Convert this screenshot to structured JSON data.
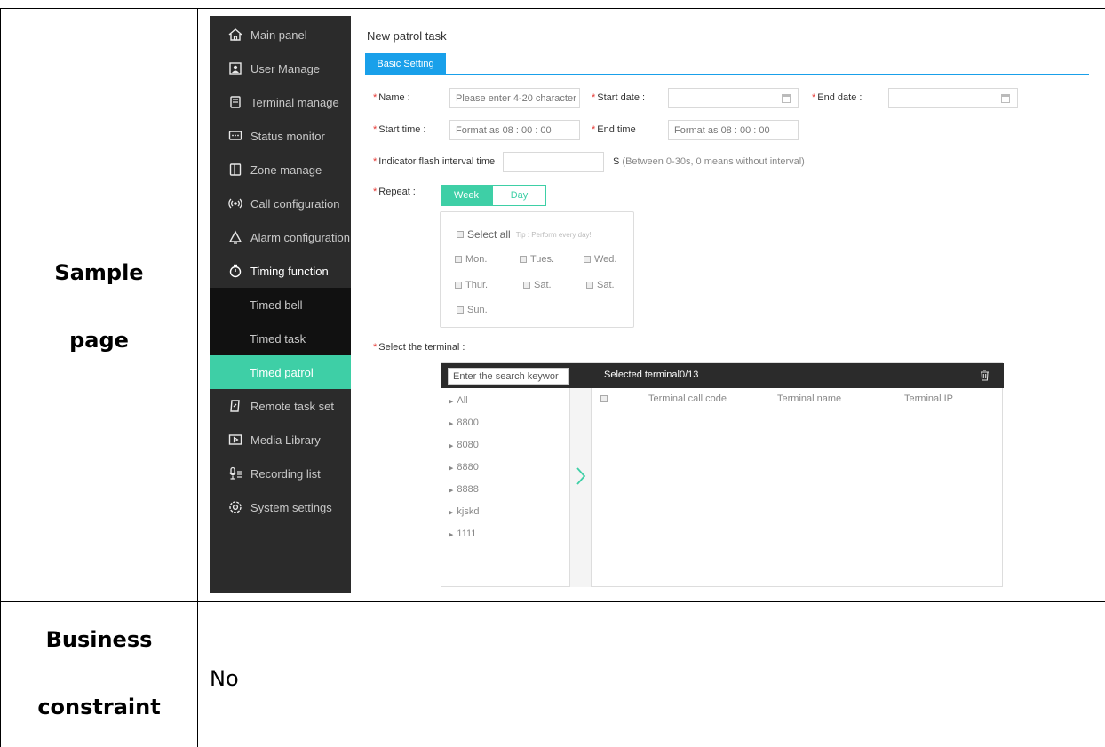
{
  "doc": {
    "row1_label_line1": "Sample",
    "row1_label_line2": "page",
    "row2_label_line1": "Business",
    "row2_label_line2": "constraint",
    "row2_value": "No"
  },
  "sidebar": {
    "items": [
      {
        "label": "Main panel",
        "icon": "home-icon"
      },
      {
        "label": "User Manage",
        "icon": "user-card-icon"
      },
      {
        "label": "Terminal manage",
        "icon": "terminal-icon"
      },
      {
        "label": "Status monitor",
        "icon": "monitor-icon"
      },
      {
        "label": "Zone manage",
        "icon": "zone-icon"
      },
      {
        "label": "Call configuration",
        "icon": "broadcast-icon"
      },
      {
        "label": "Alarm configuration",
        "icon": "bell-icon"
      },
      {
        "label": "Timing function",
        "icon": "stopwatch-icon"
      },
      {
        "label": "Timed bell"
      },
      {
        "label": "Timed task"
      },
      {
        "label": "Timed patrol"
      },
      {
        "label": "Remote task set",
        "icon": "remote-task-icon"
      },
      {
        "label": "Media Library",
        "icon": "media-icon"
      },
      {
        "label": "Recording list",
        "icon": "microphone-icon"
      },
      {
        "label": "System settings",
        "icon": "gear-icon"
      }
    ]
  },
  "form": {
    "title": "New patrol task",
    "tab": "Basic Setting",
    "star": "*",
    "name_label": "Name :",
    "name_placeholder": "Please enter 4-20 character",
    "start_date_label": "Start date :",
    "end_date_label": "End date :",
    "start_time_label": "Start time :",
    "start_time_placeholder": "Format as 08 : 00 : 00",
    "end_time_label": "End time",
    "end_time_placeholder": "Format as 08 : 00 : 00",
    "interval_label": "Indicator flash interval time",
    "interval_unit": "S",
    "interval_hint": "(Between 0-30s, 0 means without interval)",
    "repeat_label": "Repeat :",
    "repeat_options": [
      "Week",
      "Day"
    ],
    "select_all": "Select all",
    "tip": "Tip : Perform every day!",
    "days": [
      "Mon.",
      "Tues.",
      "Wed.",
      "Thur.",
      "Sat.",
      "Sat.",
      "Sun."
    ],
    "terminal_label": "Select the terminal :"
  },
  "terminal": {
    "search_placeholder": "Enter the search keywor",
    "selected": "Selected terminal0/13",
    "tree": [
      "All",
      "8800",
      "8080",
      "8880",
      "8888",
      "kjskd",
      "1111"
    ],
    "columns": [
      "Terminal call code",
      "Terminal name",
      "Terminal IP"
    ]
  },
  "colors": {
    "accent": "#3ecfa6",
    "tab_blue": "#19a0ea",
    "sidebar_bg": "#2b2b2b",
    "required": "#e53935"
  }
}
